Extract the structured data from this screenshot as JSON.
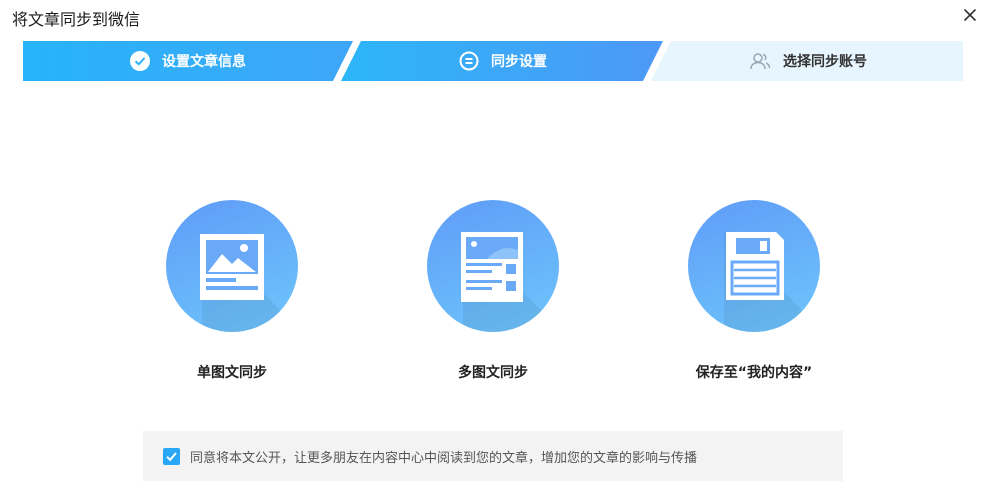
{
  "dialog": {
    "title": "将文章同步到微信",
    "close_icon": "close-icon"
  },
  "steps": [
    {
      "label": "设置文章信息",
      "icon": "check-circle-icon",
      "state": "completed"
    },
    {
      "label": "同步设置",
      "icon": "equal-circle-icon",
      "state": "active"
    },
    {
      "label": "选择同步账号",
      "icon": "users-icon",
      "state": "pending"
    }
  ],
  "options": [
    {
      "label": "单图文同步",
      "icon": "single-image-article-icon"
    },
    {
      "label": "多图文同步",
      "icon": "multi-image-article-icon"
    },
    {
      "label": "保存至“我的内容”",
      "icon": "save-floppy-icon"
    }
  ],
  "agreement": {
    "checked": true,
    "text": "同意将本文公开，让更多朋友在内容中心中阅读到您的文章，增加您的文章的影响与传播"
  },
  "colors": {
    "step_blue": "#2fb1f7",
    "step_blue_dark": "#4b9df7",
    "step_pending": "#e7f5fe",
    "circle_start": "#5f9cf8",
    "circle_end": "#6ec6fb",
    "checkbox": "#2aa6f6"
  }
}
